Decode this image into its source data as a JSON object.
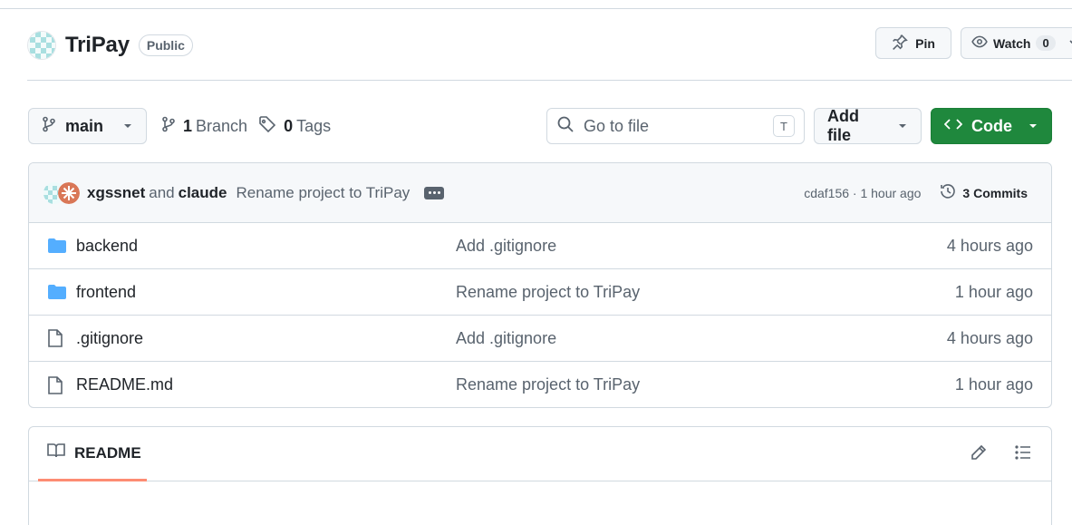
{
  "repo": {
    "name": "TriPay",
    "visibility": "Public"
  },
  "header_actions": {
    "pin_label": "Pin",
    "watch_label": "Watch",
    "watch_count": "0"
  },
  "toolbar": {
    "branch": "main",
    "branch_count": "1",
    "branch_label": "Branch",
    "tag_count": "0",
    "tag_label": "Tags",
    "search_placeholder": "Go to file",
    "search_shortcut": "T",
    "add_file_label": "Add file",
    "code_label": "Code",
    "code_color": "#1f883d"
  },
  "latest_commit": {
    "author1": "xgssnet",
    "joiner": "and",
    "author2": "claude",
    "message": "Rename project to TriPay",
    "hash_time": "cdaf156 · 1 hour ago",
    "commits_label": "3 Commits"
  },
  "files": [
    {
      "type": "folder",
      "icon": "folder-icon",
      "name": "backend",
      "message": "Add .gitignore",
      "age": "4 hours ago"
    },
    {
      "type": "folder",
      "icon": "folder-icon",
      "name": "frontend",
      "message": "Rename project to TriPay",
      "age": "1 hour ago"
    },
    {
      "type": "file",
      "icon": "file-icon",
      "name": ".gitignore",
      "message": "Add .gitignore",
      "age": "4 hours ago"
    },
    {
      "type": "file",
      "icon": "file-icon",
      "name": "README.md",
      "message": "Rename project to TriPay",
      "age": "1 hour ago"
    }
  ],
  "readme": {
    "tab_label": "README",
    "tab_accent": "#fd8c73"
  },
  "colors": {
    "folder": "#54aeff",
    "muted": "#59636e",
    "border": "#d1d9e0"
  }
}
